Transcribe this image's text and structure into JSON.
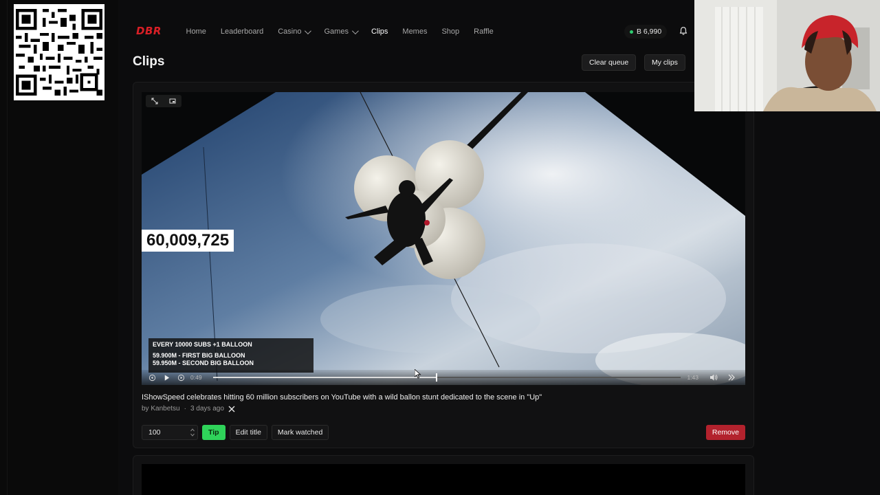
{
  "nav": {
    "logo": "DBR",
    "items": [
      {
        "label": "Home"
      },
      {
        "label": "Leaderboard"
      },
      {
        "label": "Casino"
      },
      {
        "label": "Games"
      },
      {
        "label": "Clips"
      },
      {
        "label": "Memes"
      },
      {
        "label": "Shop"
      },
      {
        "label": "Raffle"
      }
    ],
    "active": "Clips",
    "balance": "B 6,990"
  },
  "page": {
    "title": "Clips",
    "clear_queue": "Clear queue",
    "my_clips": "My clips"
  },
  "clip": {
    "overlay_counter": "60,009,725",
    "overlay_lines": [
      "EVERY 10000 SUBS +1 BALLOON",
      "59.900M - FIRST BIG BALLOON",
      "59.950M - SECOND BIG BALLOON"
    ],
    "current_time": "0:49",
    "duration": "1:43",
    "progress": 0.476,
    "title": "IShowSpeed celebrates hitting 60 million subscribers on YouTube with a wild ballon stunt dedicated to the scene in \"Up\"",
    "author": "by Kanbetsu",
    "age": "3 days ago",
    "tip_amount": "100",
    "tip_label": "Tip",
    "edit_title_label": "Edit title",
    "mark_watched_label": "Mark watched",
    "remove_label": "Remove"
  },
  "colors": {
    "accent_green": "#2fd35a",
    "danger_red": "#b3222d",
    "logo_red": "#d91f26"
  }
}
